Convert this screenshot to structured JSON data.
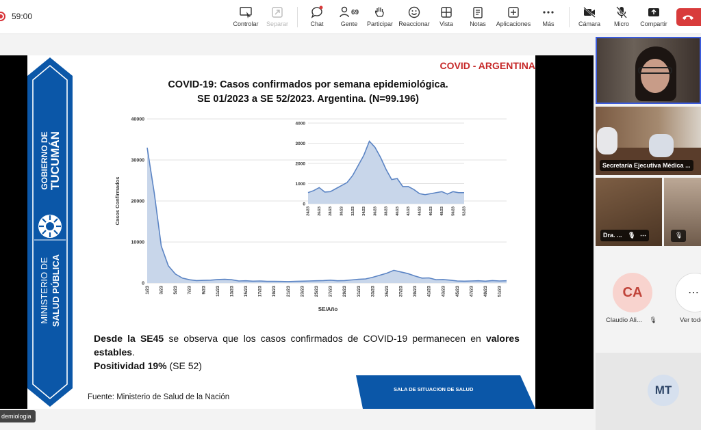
{
  "timer": "59:00",
  "toolbar": {
    "items": [
      {
        "label": "Controlar",
        "icon": "screen-control-icon",
        "disabled": false
      },
      {
        "label": "Separar",
        "icon": "separate-icon",
        "disabled": true
      },
      {
        "label": "Chat",
        "icon": "chat-icon",
        "disabled": false
      },
      {
        "label": "Gente",
        "icon": "people-icon",
        "count": "69",
        "disabled": false
      },
      {
        "label": "Participar",
        "icon": "raise-hand-icon",
        "disabled": false
      },
      {
        "label": "Reaccionar",
        "icon": "smiley-icon",
        "disabled": false
      },
      {
        "label": "Vista",
        "icon": "grid-view-icon",
        "disabled": false
      },
      {
        "label": "Notas",
        "icon": "notes-icon",
        "disabled": false
      },
      {
        "label": "Aplicaciones",
        "icon": "apps-icon",
        "disabled": false
      },
      {
        "label": "Más",
        "icon": "more-icon",
        "disabled": false
      },
      {
        "label": "Cámara",
        "icon": "camera-off-icon",
        "disabled": false
      },
      {
        "label": "Micro",
        "icon": "mic-off-icon",
        "disabled": false
      },
      {
        "label": "Compartir",
        "icon": "share-icon",
        "disabled": false
      }
    ]
  },
  "slide": {
    "banner_gov_line1": "GOBIERNO DE",
    "banner_gov_line2": "TUCUMÁN",
    "banner_min_line1": "MINISTERIO DE",
    "banner_min_line2": "SALUD PÚBLICA",
    "tag": "COVID - ARGENTINA",
    "title_line1": "COVID-19: Casos confirmados por semana epidemiológica.",
    "title_line2": "SE 01/2023 a SE 52/2023. Argentina. (N=99.196)",
    "body": {
      "p1_bold": "Desde la SE45",
      "p1_rest": " se observa que los casos confirmados de COVID-19 permanecen en ",
      "p1_bold2": "valores estables",
      "p1_end": ".",
      "p2_bold": "Positividad 19%",
      "p2_rest": " (SE 52)"
    },
    "source": "Fuente: Ministerio de Salud de la Nación",
    "sala": "SALA DE SITUACION  DE SALUD"
  },
  "participants": {
    "dr_label": "Dra. ...",
    "secretaria_label": "Secretaría Ejecutiva Médica ...",
    "ca_initials": "CA",
    "ca_name": "Claudio Ali...",
    "all_label": "Ver todo",
    "mt_initials": "MT"
  },
  "bottom_chip": "demiologia",
  "colors": {
    "accent": "#0b57a8",
    "area_fill": "#c8d6ea",
    "area_stroke": "#5b84c4",
    "danger": "#d83b3b"
  },
  "chart_data": [
    {
      "type": "area",
      "title": "",
      "xlabel": "SE/Año",
      "ylabel": "Casos Confirmados",
      "ylim": [
        0,
        40000
      ],
      "yticks": [
        0,
        10000,
        20000,
        30000,
        40000
      ],
      "x": [
        1,
        2,
        3,
        4,
        5,
        6,
        7,
        8,
        9,
        10,
        11,
        12,
        13,
        14,
        15,
        16,
        17,
        18,
        19,
        20,
        21,
        22,
        23,
        24,
        25,
        26,
        27,
        28,
        29,
        30,
        31,
        32,
        33,
        34,
        35,
        36,
        37,
        38,
        39,
        40,
        41,
        42,
        43,
        44,
        45,
        46,
        47,
        48,
        49,
        50,
        51,
        52
      ],
      "xtick_labels": [
        "1/23",
        "3/23",
        "5/23",
        "7/23",
        "9/23",
        "11/23",
        "13/23",
        "15/23",
        "17/23",
        "19/23",
        "21/23",
        "23/23",
        "25/23",
        "27/23",
        "29/23",
        "31/23",
        "33/23",
        "35/23",
        "37/23",
        "39/23",
        "41/23",
        "43/23",
        "45/23",
        "47/23",
        "49/23",
        "51/23"
      ],
      "values": [
        33000,
        22000,
        9000,
        4200,
        2200,
        1200,
        800,
        600,
        650,
        700,
        850,
        900,
        800,
        500,
        550,
        450,
        500,
        400,
        400,
        380,
        350,
        400,
        450,
        500,
        550,
        600,
        700,
        550,
        600,
        750,
        900,
        1000,
        1400,
        1900,
        2400,
        3100,
        2700,
        2300,
        1700,
        1200,
        1250,
        800,
        850,
        700,
        500,
        450,
        500,
        550,
        450,
        600,
        500,
        550
      ],
      "grid": true
    },
    {
      "type": "area",
      "title": "",
      "ylim": [
        0,
        4000
      ],
      "yticks": [
        0,
        1000,
        2000,
        3000,
        4000
      ],
      "x": [
        24,
        25,
        26,
        27,
        28,
        29,
        30,
        31,
        32,
        33,
        34,
        35,
        36,
        37,
        38,
        39,
        40,
        41,
        42,
        43,
        44,
        45,
        46,
        47,
        48,
        49,
        50,
        51,
        52
      ],
      "xtick_labels": [
        "24/23",
        "26/23",
        "28/23",
        "30/23",
        "32/23",
        "34/23",
        "36/23",
        "38/23",
        "40/23",
        "42/23",
        "44/23",
        "46/23",
        "48/23",
        "50/23",
        "52/23"
      ],
      "values": [
        550,
        650,
        800,
        580,
        600,
        750,
        900,
        1050,
        1400,
        1900,
        2400,
        3100,
        2800,
        2300,
        1700,
        1200,
        1250,
        850,
        850,
        700,
        500,
        450,
        500,
        550,
        600,
        480,
        600,
        550,
        550
      ],
      "grid": true
    }
  ]
}
